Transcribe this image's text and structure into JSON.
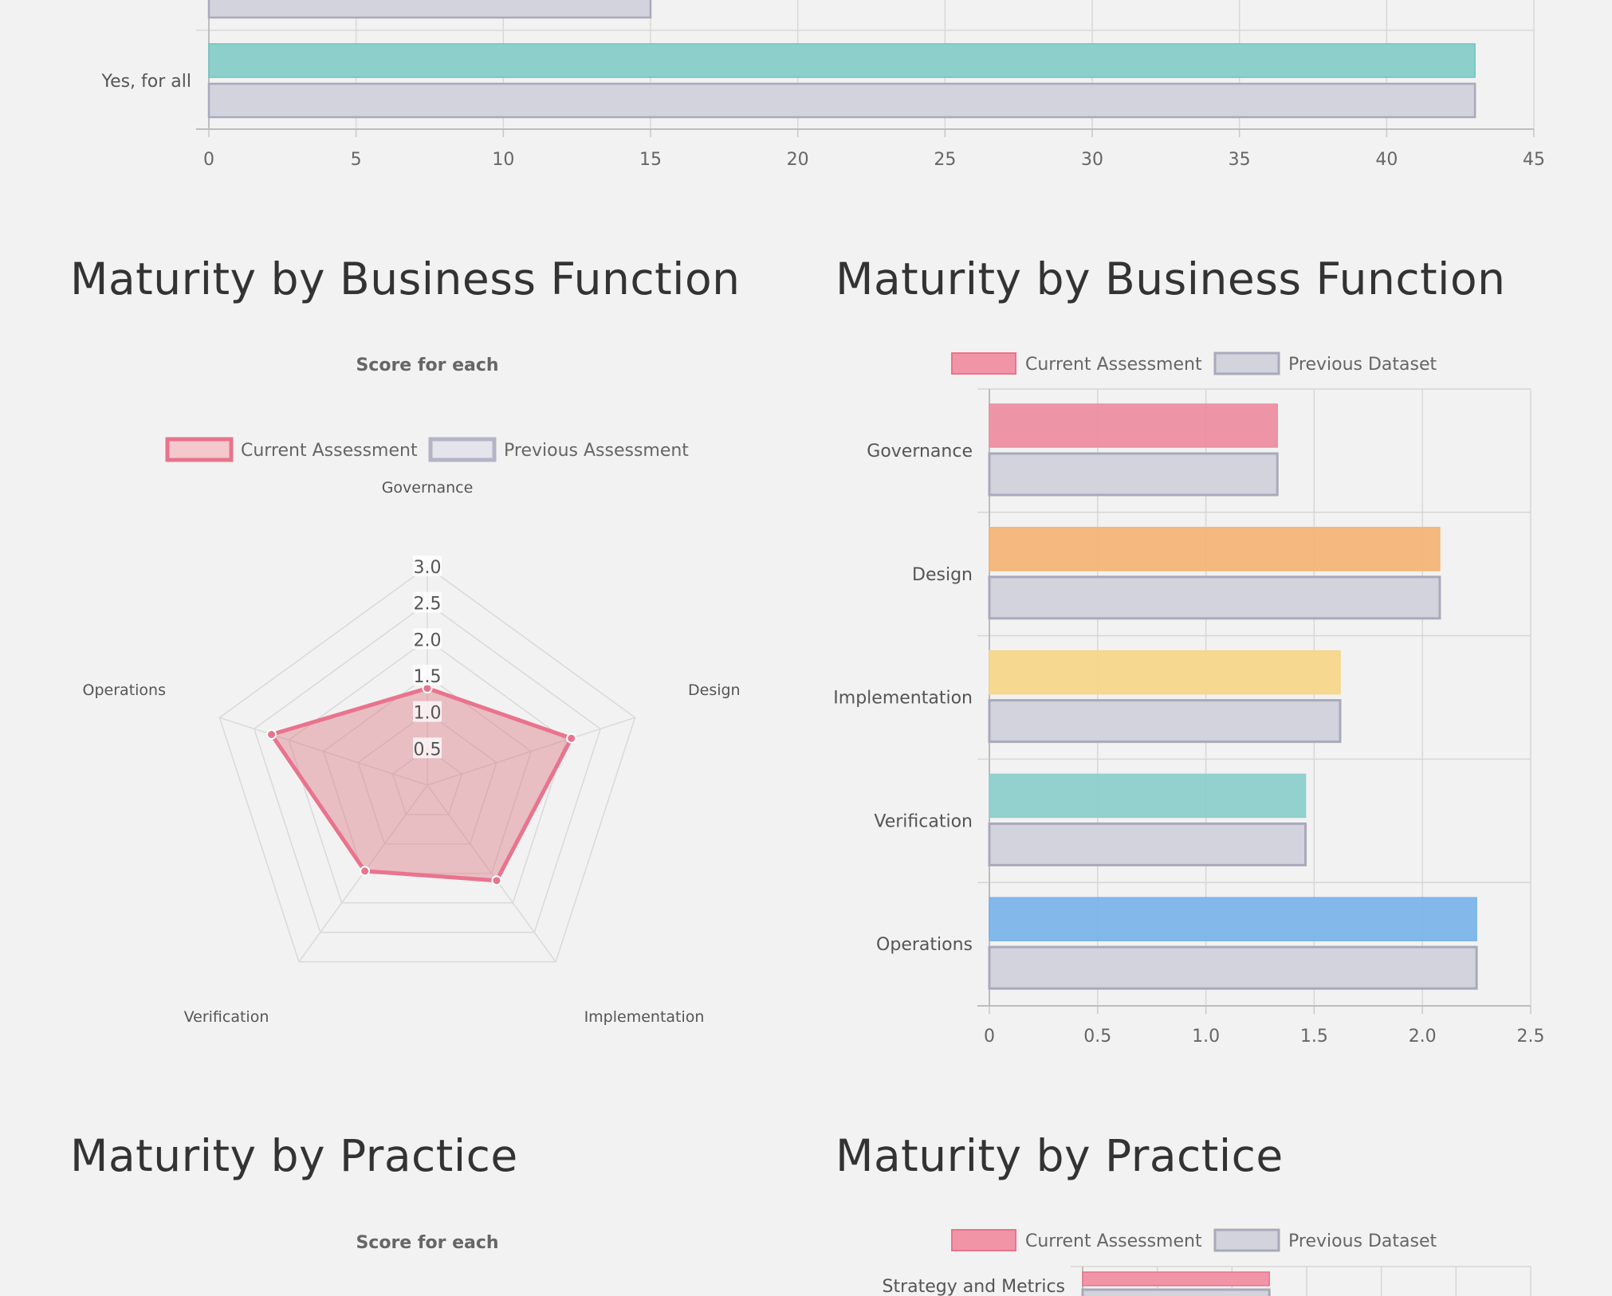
{
  "sections": {
    "bf_radar_title": "Maturity by Business Function",
    "bf_bar_title": "Maturity by Business Function",
    "pr_radar_title": "Maturity by Practice",
    "pr_bar_title": "Maturity by Practice"
  },
  "colors": {
    "background": "#f2f2f2",
    "current_red": "#ec7d92",
    "previous_gray": "#d3d3de",
    "previous_border": "#a9a9bb",
    "teal": "#8dcfcb",
    "orange": "#f4b478",
    "yellow": "#f6d68a",
    "blue": "#7bb4e9"
  },
  "chart_data": [
    {
      "id": "top_bar",
      "type": "bar",
      "orientation": "horizontal",
      "categories": [
        "Yes, for all"
      ],
      "series": [
        {
          "values": [
            43
          ],
          "color": "#8dcfcb"
        },
        {
          "values": [
            43
          ],
          "color": "#d3d3de"
        }
      ],
      "partial_bar_above": {
        "value": 15
      },
      "xticks": [
        "0",
        "5",
        "10",
        "15",
        "20",
        "25",
        "30",
        "35",
        "40",
        "45"
      ],
      "xlim": [
        0,
        45
      ],
      "grid": true
    },
    {
      "id": "bf_radar",
      "type": "radar",
      "title": "Score for each",
      "axes": [
        "Governance",
        "Design",
        "Implementation",
        "Verification",
        "Operations"
      ],
      "series": [
        {
          "name": "Current Assessment",
          "values": [
            1.33,
            2.08,
            1.62,
            1.46,
            2.25
          ],
          "color": "#e9738d"
        },
        {
          "name": "Previous Assessment",
          "values": [
            1.33,
            2.08,
            1.62,
            1.46,
            2.25
          ],
          "color": "#b4b4c6"
        }
      ],
      "rticks": [
        "0.5",
        "1.0",
        "1.5",
        "2.0",
        "2.5",
        "3.0"
      ],
      "rlim": [
        0,
        3
      ]
    },
    {
      "id": "bf_bar",
      "type": "bar",
      "orientation": "horizontal",
      "categories": [
        "Governance",
        "Design",
        "Implementation",
        "Verification",
        "Operations"
      ],
      "series": [
        {
          "name": "Current Assessment",
          "values": [
            1.33,
            2.08,
            1.62,
            1.46,
            2.25
          ],
          "colors": [
            "#ec8fa1",
            "#f4b478",
            "#f6d68a",
            "#8dcfcb",
            "#7bb4e9"
          ]
        },
        {
          "name": "Previous Dataset",
          "values": [
            1.33,
            2.08,
            1.62,
            1.46,
            2.25
          ],
          "color": "#d3d3de"
        }
      ],
      "xticks": [
        "0",
        "0.5",
        "1.0",
        "1.5",
        "2.0",
        "2.5"
      ],
      "xlim": [
        0,
        2.5
      ],
      "grid": true,
      "legend": "top"
    },
    {
      "id": "pr_radar",
      "type": "radar",
      "title": "Score for each"
    },
    {
      "id": "pr_bar",
      "type": "bar",
      "orientation": "horizontal",
      "categories": [
        "Strategy and Metrics"
      ],
      "series": [
        {
          "name": "Current Assessment",
          "values": [
            1.25
          ],
          "color": "#ec8fa1"
        },
        {
          "name": "Previous Dataset",
          "values": [
            1.25
          ],
          "color": "#d3d3de"
        }
      ],
      "xlim": [
        0,
        3
      ],
      "legend": "top"
    }
  ]
}
